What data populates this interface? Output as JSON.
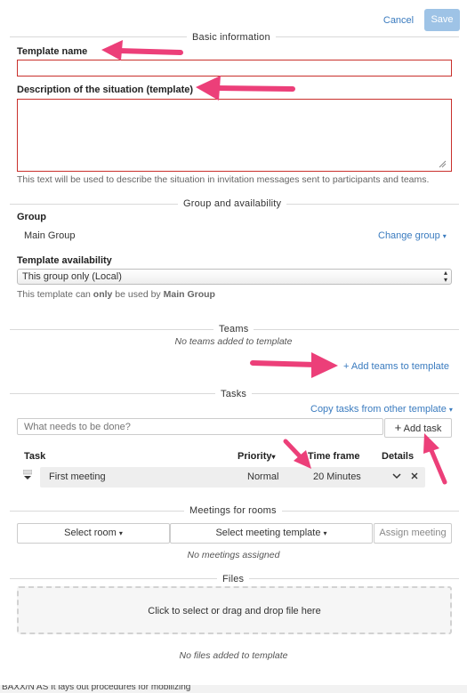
{
  "header": {
    "cancel_label": "Cancel",
    "save_label": "Save"
  },
  "basic": {
    "section_title": "Basic information",
    "template_name_label": "Template name",
    "template_name_value": "",
    "description_label": "Description of the situation (template)",
    "description_value": "",
    "description_help": "This text will be used to describe the situation in invitation messages sent to participants and teams."
  },
  "group": {
    "section_title": "Group and availability",
    "group_label": "Group",
    "group_value": "Main Group",
    "change_group_label": "Change group",
    "availability_label": "Template availability",
    "availability_selected": "This group only (Local)",
    "availability_note_prefix": "This template can ",
    "availability_note_only": "only",
    "availability_note_mid": " be used by ",
    "availability_note_group": "Main Group"
  },
  "teams": {
    "section_title": "Teams",
    "empty_text": "No teams added to template",
    "add_label": "Add teams to template"
  },
  "tasks": {
    "section_title": "Tasks",
    "copy_label": "Copy tasks from other template",
    "input_placeholder": "What needs to be done?",
    "add_task_label": "Add task",
    "columns": {
      "task": "Task",
      "priority": "Priority",
      "time_frame": "Time frame",
      "details": "Details"
    },
    "rows": [
      {
        "task": "First meeting",
        "priority": "Normal",
        "time_frame": "20 Minutes"
      }
    ]
  },
  "meetings": {
    "section_title": "Meetings for rooms",
    "select_room_label": "Select room",
    "select_template_label": "Select meeting template",
    "assign_label": "Assign meeting",
    "empty_text": "No meetings assigned"
  },
  "files": {
    "section_title": "Files",
    "drop_label": "Click to select or drag and drop file here",
    "empty_text": "No files added to template"
  },
  "footer": {
    "cut_text": "BAXX/N AS It lays out procedures for mobilizing"
  },
  "colors": {
    "accent": "#3a7bbf",
    "error_border": "#c9302c",
    "annotation_arrow": "#ec3f79",
    "save_button": "#9ec3e6"
  }
}
